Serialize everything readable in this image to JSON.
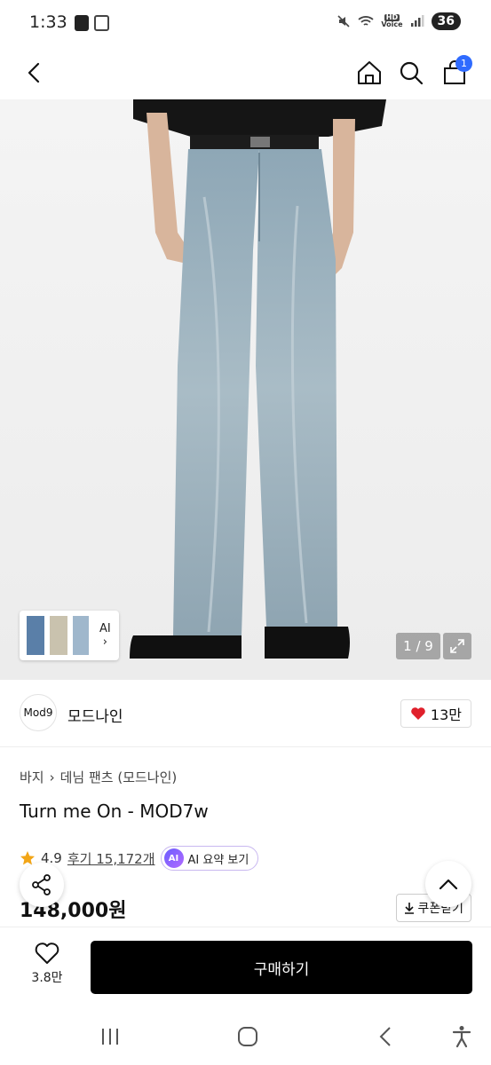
{
  "status_bar": {
    "time": "1:33",
    "battery": "36",
    "hd_label": "HD",
    "voice_label": "Voice"
  },
  "nav": {
    "cart_count": "1"
  },
  "gallery": {
    "thumb_label": "AI",
    "page_counter": "1 / 9"
  },
  "brand": {
    "logo_text": "Mod9",
    "name": "모드나인",
    "likes": "13만"
  },
  "breadcrumb": {
    "category": "바지",
    "subcategory": "데님 팬츠 (모드나인)"
  },
  "product": {
    "title": "Turn me On - MOD7w",
    "rating": "4.9",
    "reviews": "후기 15,172개",
    "ai_badge": "AI",
    "ai_summary_label": "AI 요약 보기",
    "price": "148,000원",
    "coupon_label": "쿠폰받기"
  },
  "bottom_bar": {
    "wish_count": "3.8만",
    "buy_label": "구매하기"
  },
  "colors": {
    "accent_blue": "#2f6bff",
    "heart_red": "#e0202b",
    "star_gold": "#f2a516",
    "buy_button": "#000000"
  }
}
